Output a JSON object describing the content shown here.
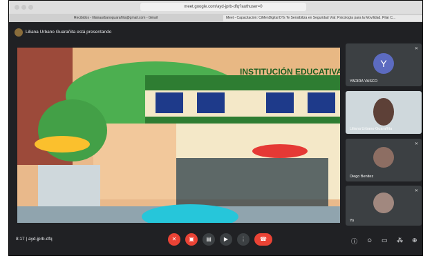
{
  "browser": {
    "url": "meet.google.com/ayd-jprb-dfq?authuser=0",
    "tabs": [
      "Recibidos - lilianaurbanoguarañita@gmail.com - Gmail",
      "Meet - Capacitación: CiMenDigital DTs Te Sensibiliza en Seguridad Vial: Psicología para la Movilidad. Pilar C..."
    ]
  },
  "presentation": {
    "presenter": "Liliana Urbano Guarañita está presentando"
  },
  "stage": {
    "sign": "INSTITUCIÓN EDUCATIVA"
  },
  "participants": [
    {
      "name": "YADIRA VASCO",
      "initial": "Y"
    },
    {
      "name": "Liliana Urbano Guarañita"
    },
    {
      "name": "Diego Benitez"
    },
    {
      "name": "Yo"
    }
  ],
  "bottom": {
    "time": "8:17",
    "code": "ayd-jprb-dfq"
  },
  "colors": {
    "bg": "#202124",
    "red": "#ea4335",
    "avatar": "#5c6bc0"
  }
}
